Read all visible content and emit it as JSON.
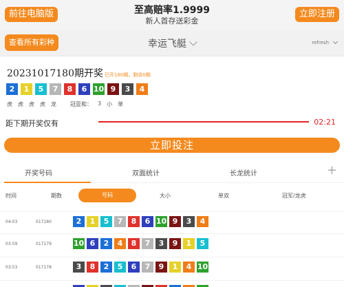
{
  "header": {
    "left_button": "前往电脑版",
    "right_button": "立即注册",
    "title": "至高赔率1.9999",
    "subtitle": "新人首存送彩金"
  },
  "subheader": {
    "all_lottery_button": "查看所有彩种",
    "game_name": "幸运飞艇",
    "user_label": "refresh"
  },
  "current_draw": {
    "title": "20231017180期开奖",
    "meta": "已开180期，剩余0期",
    "numbers": [
      "2",
      "1",
      "5",
      "7",
      "8",
      "6",
      "10",
      "9",
      "3",
      "4"
    ],
    "tags": [
      "虎",
      "虎",
      "虎",
      "虎",
      "龙"
    ],
    "champion_sum_label": "冠亚和：",
    "champion_sum_value": "3",
    "size": "小",
    "parity": "单"
  },
  "countdown": {
    "label": "距下期开奖仅有",
    "time": "02:21"
  },
  "bet_button": "立即投注",
  "tabs": [
    "开奖号码",
    "双面统计",
    "长龙统计"
  ],
  "subtabs": [
    "时间",
    "期数",
    "号码",
    "大小",
    "单双",
    "冠军/龙虎"
  ],
  "rows": [
    {
      "time": "04:03",
      "issue": "017180",
      "numbers": [
        "2",
        "1",
        "5",
        "7",
        "8",
        "6",
        "10",
        "9",
        "3",
        "4"
      ]
    },
    {
      "time": "03:59",
      "issue": "017179",
      "numbers": [
        "10",
        "6",
        "2",
        "4",
        "8",
        "7",
        "3",
        "9",
        "1",
        "5"
      ]
    },
    {
      "time": "03:53",
      "issue": "017178",
      "numbers": [
        "3",
        "8",
        "2",
        "5",
        "6",
        "7",
        "9",
        "1",
        "4",
        "10"
      ]
    }
  ],
  "colors": {
    "accent": "#f48a1e",
    "countdown_red": "#e52121",
    "ball_1": "#e6d12a",
    "ball_2": "#1c6fd6",
    "ball_3": "#4a4a4a",
    "ball_4": "#f07d18",
    "ball_5": "#17bfd0",
    "ball_6": "#2f3fbd",
    "ball_7": "#b7b7b7",
    "ball_8": "#e0312c",
    "ball_9": "#7a1414",
    "ball_10": "#2ea12e"
  }
}
